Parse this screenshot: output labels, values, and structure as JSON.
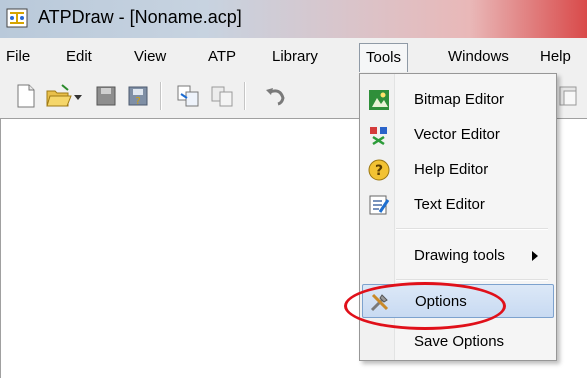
{
  "window": {
    "title": "ATPDraw - [Noname.acp]"
  },
  "menubar": {
    "items": [
      {
        "label": "File",
        "mnemonic": "F"
      },
      {
        "label": "Edit",
        "mnemonic": "E"
      },
      {
        "label": "View",
        "mnemonic": "V"
      },
      {
        "label": "ATP",
        "mnemonic": "A"
      },
      {
        "label": "Library",
        "mnemonic": "L"
      },
      {
        "label": "Tools",
        "mnemonic": "T"
      },
      {
        "label": "Windows",
        "mnemonic": "W"
      },
      {
        "label": "Help",
        "mnemonic": "H"
      }
    ]
  },
  "tools_menu": {
    "items": [
      {
        "label": "Bitmap Editor",
        "icon": "bitmap-editor-icon"
      },
      {
        "label": "Vector Editor",
        "icon": "vector-editor-icon"
      },
      {
        "label": "Help Editor",
        "icon": "help-editor-icon"
      },
      {
        "label": "Text Editor",
        "icon": "text-editor-icon"
      },
      {
        "label": "Drawing tools",
        "icon": "none",
        "submenu": true
      },
      {
        "label": "Options",
        "icon": "options-icon",
        "highlighted": true
      },
      {
        "label": "Save Options",
        "icon": "none"
      }
    ]
  },
  "colors": {
    "highlight": "#c8daf2",
    "annotation": "#e0101a"
  }
}
